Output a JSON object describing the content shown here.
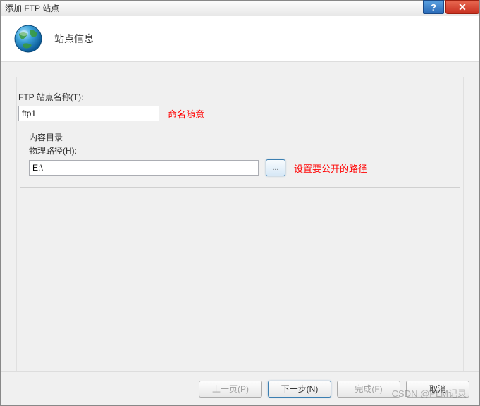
{
  "window": {
    "title": "添加 FTP 站点",
    "help_label": "?",
    "close_label": "✕"
  },
  "header": {
    "title": "站点信息"
  },
  "form": {
    "site_name": {
      "label": "FTP 站点名称(T):",
      "value": "ftp1",
      "annotation": "命名随意"
    },
    "content_dir": {
      "legend": "内容目录",
      "path_label": "物理路径(H):",
      "path_value": "E:\\",
      "browse_label": "...",
      "annotation": "设置要公开的路径"
    }
  },
  "footer": {
    "prev": "上一页(P)",
    "next": "下一步(N)",
    "finish": "完成(F)",
    "cancel": "取消"
  },
  "watermark": "CSDN @PLM记录"
}
